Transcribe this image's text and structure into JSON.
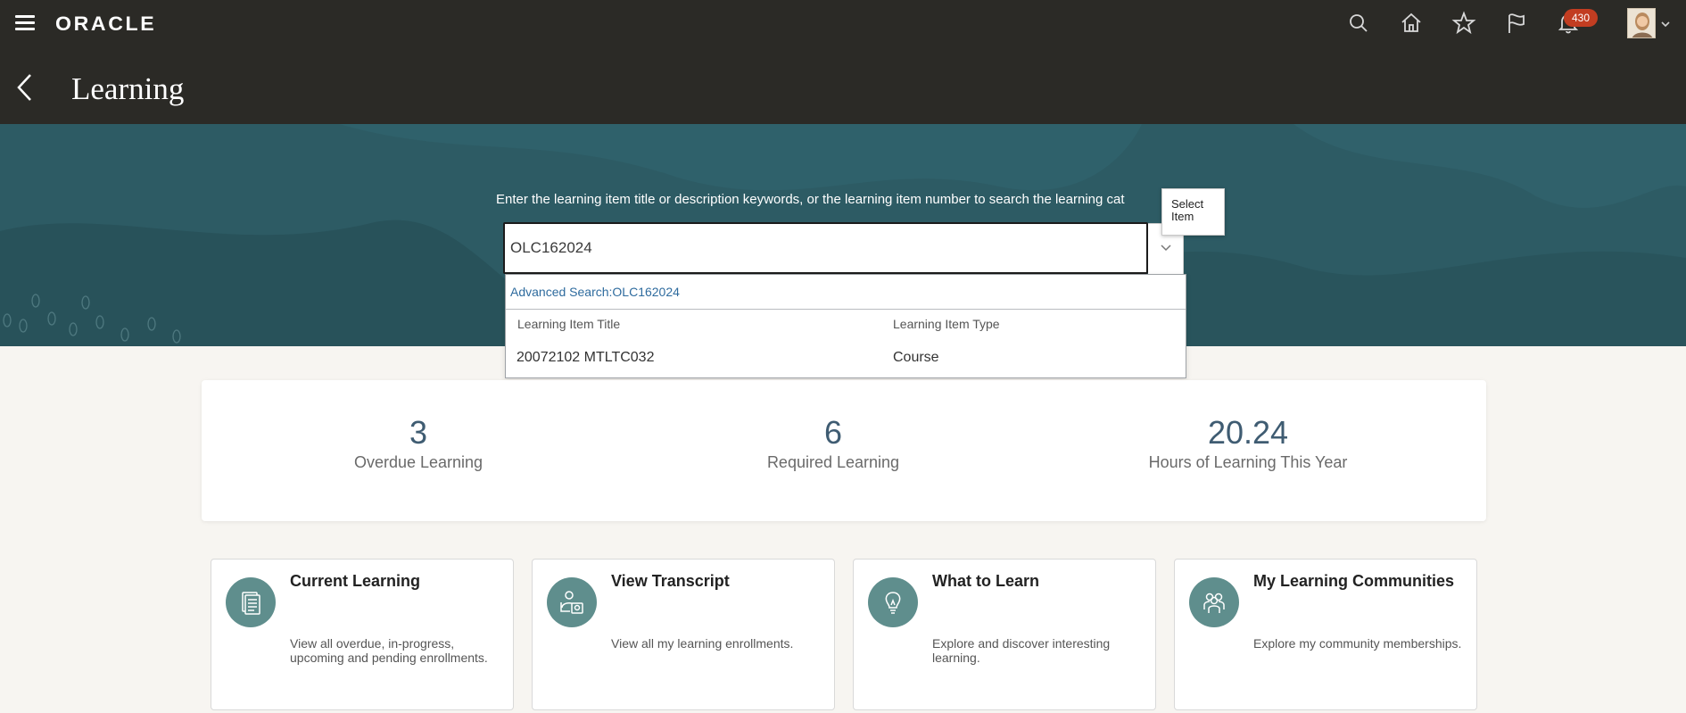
{
  "header": {
    "logo": "ORACLE",
    "notifications_count": "430",
    "page_title": "Learning"
  },
  "search": {
    "prompt": "Enter the learning item title or description keywords, or the learning item number to search the learning cat",
    "value": "OLC162024",
    "tooltip": "Select Item",
    "advanced_search": "Advanced Search:OLC162024",
    "columns": [
      "Learning Item Title",
      "Learning Item Type"
    ],
    "results": [
      {
        "title": "20072102 MTLTC032",
        "type": "Course"
      }
    ]
  },
  "stats": [
    {
      "value": "3",
      "label": "Overdue Learning"
    },
    {
      "value": "6",
      "label": "Required Learning"
    },
    {
      "value": "20.24",
      "label": "Hours of Learning This Year"
    }
  ],
  "cards": [
    {
      "title": "Current Learning",
      "description": "View all overdue, in-progress, upcoming and pending enrollments.",
      "icon": "document-list-icon"
    },
    {
      "title": "View Transcript",
      "description": "View all my learning enrollments.",
      "icon": "person-certificate-icon"
    },
    {
      "title": "What to Learn",
      "description": "Explore and discover interesting learning.",
      "icon": "lightbulb-icon"
    },
    {
      "title": "My Learning Communities",
      "description": "Explore my community memberships.",
      "icon": "group-icon"
    }
  ],
  "colors": {
    "header_bg": "#2b2a26",
    "hero_bg": "#2c5a63",
    "accent_teal": "#5f8e8d",
    "stat_number": "#3f5c72",
    "badge": "#c23d21",
    "link": "#2e6b9e"
  }
}
